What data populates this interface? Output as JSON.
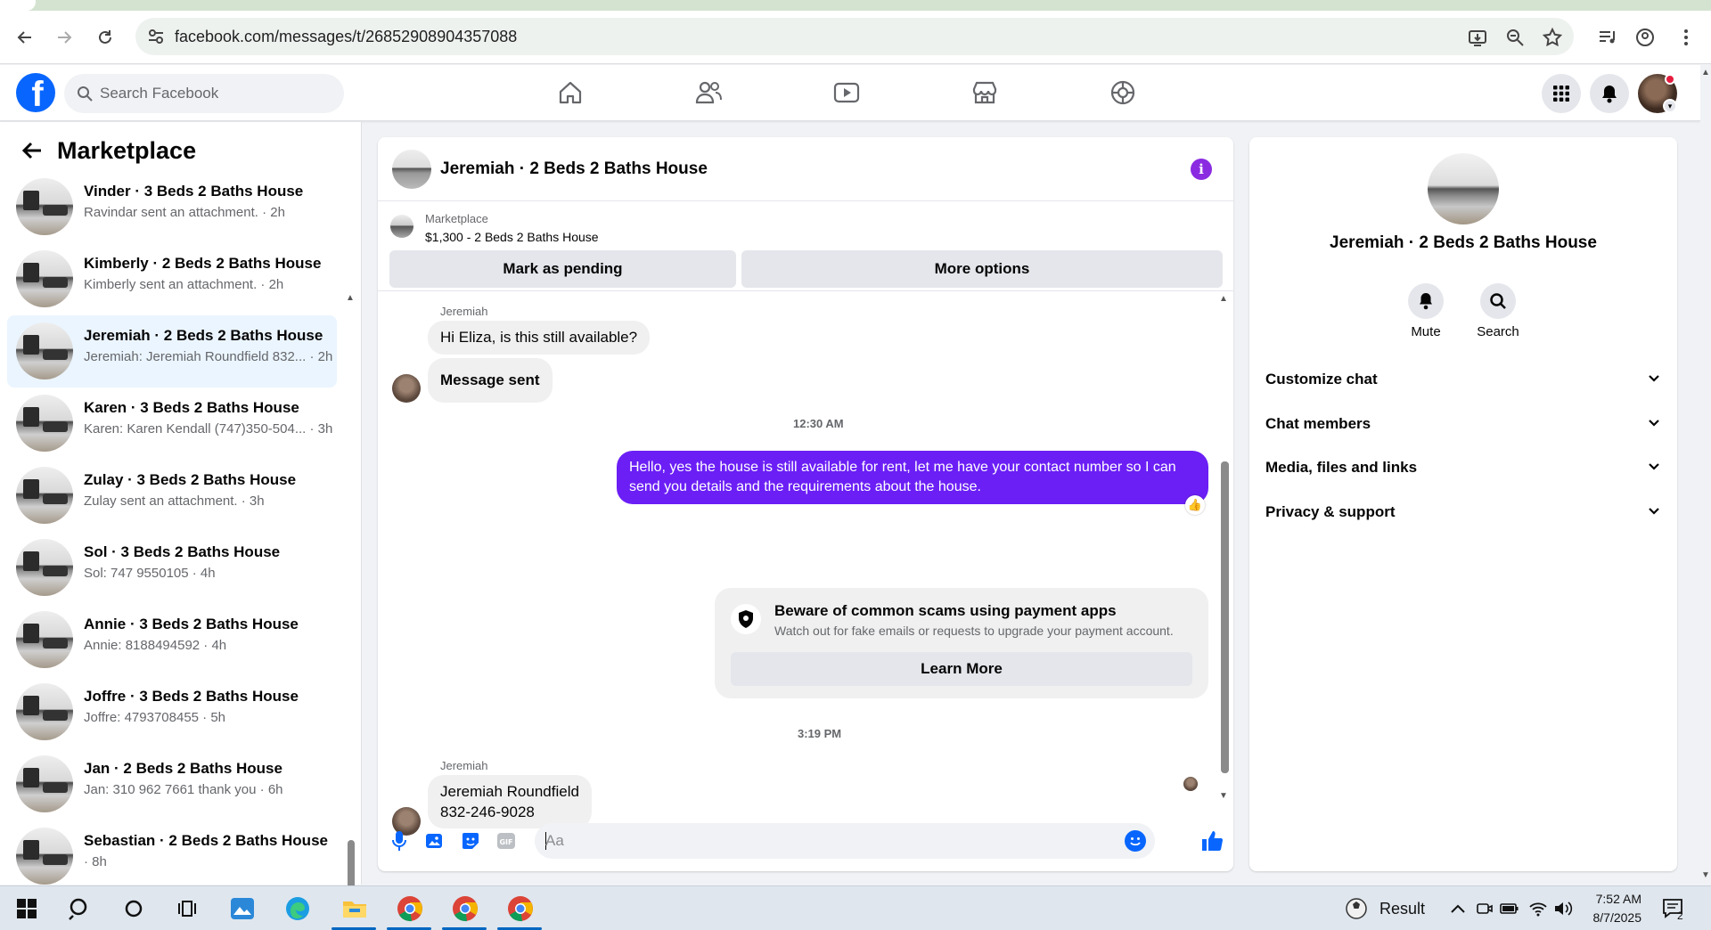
{
  "browser": {
    "url": "facebook.com/messages/t/26852908904357088"
  },
  "header": {
    "search_placeholder": "Search Facebook"
  },
  "sidebar": {
    "title": "Marketplace",
    "conversations": [
      {
        "name": "Vinder · 3 Beds 2 Baths House",
        "preview": "Ravindar sent an attachment. · 2h"
      },
      {
        "name": "Kimberly · 2 Beds 2 Baths House",
        "preview": "Kimberly sent an attachment. · 2h"
      },
      {
        "name": "Jeremiah · 2 Beds 2 Baths House",
        "preview": "Jeremiah: Jeremiah Roundfield 832... · 2h"
      },
      {
        "name": "Karen · 3 Beds 2 Baths House",
        "preview": "Karen: Karen Kendall (747)350-504... · 3h"
      },
      {
        "name": "Zulay · 3 Beds 2 Baths House",
        "preview": "Zulay sent an attachment. · 3h"
      },
      {
        "name": "Sol · 3 Beds 2 Baths House",
        "preview": "Sol: 747 9550105 · 4h"
      },
      {
        "name": "Annie · 3 Beds 2 Baths House",
        "preview": "Annie: 8188494592 · 4h"
      },
      {
        "name": "Joffre · 3 Beds 2 Baths House",
        "preview": "Joffre: 4793708455 · 5h"
      },
      {
        "name": "Jan · 2 Beds 2 Baths House",
        "preview": "Jan: 310 962 7661 thank you · 6h"
      },
      {
        "name": "Sebastian · 2 Beds 2 Baths House",
        "preview": " · 8h"
      }
    ]
  },
  "chat": {
    "title": "Jeremiah · 2 Beds 2 Baths House",
    "listing_source": "Marketplace",
    "listing_price": "$1,300 - 2 Beds 2 Baths House",
    "mark_pending_label": "Mark as pending",
    "more_options_label": "More options",
    "sender_name": "Jeremiah",
    "msg1": "Hi Eliza, is this still available?",
    "msg2": "Message sent",
    "time1": "12:30 AM",
    "outgoing": "Hello, yes the house is still available for rent, let me have your contact number so I can send you details and the requirements about the house.",
    "scam_title": "Beware of common scams using payment apps",
    "scam_desc": "Watch out for fake emails or requests to upgrade your payment account.",
    "learn_more": "Learn More",
    "time2": "3:19 PM",
    "sender_name2": "Jeremiah",
    "msg3_line1": "Jeremiah Roundfield",
    "msg3_line2": "832-246-9028",
    "composer_placeholder": "Aa"
  },
  "details": {
    "name": "Jeremiah · 2 Beds 2 Baths House",
    "mute_label": "Mute",
    "search_label": "Search",
    "sections": [
      "Customize chat",
      "Chat members",
      "Media, files and links",
      "Privacy & support"
    ]
  },
  "taskbar": {
    "weather_label": "Result",
    "time": "7:52 AM",
    "date": "8/7/2025",
    "notification_count": "2"
  },
  "colors": {
    "accent": "#0866ff",
    "outgoing_bubble": "#6b1ff5",
    "info_icon": "#8a2be2"
  }
}
